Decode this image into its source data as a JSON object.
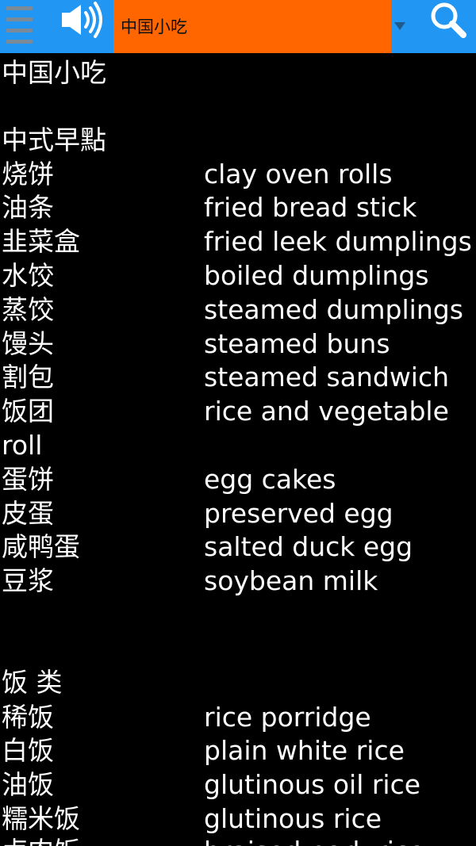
{
  "toolbar": {
    "menu_icon": "hamburger-menu-icon",
    "speaker_icon": "speaker-icon",
    "dropdown_value": "中国小吃",
    "dropdown_icon": "dropdown-arrow-icon",
    "search_icon": "search-icon"
  },
  "content": {
    "title": "中国小吃",
    "section1": {
      "heading": "中式早點",
      "items": [
        {
          "cn": "烧饼",
          "en": "clay oven rolls"
        },
        {
          "cn": "油条",
          "en": "fried bread stick"
        },
        {
          "cn": "韭菜盒",
          "en": "fried leek dumplings"
        },
        {
          "cn": "水饺",
          "en": "boiled dumplings"
        },
        {
          "cn": "蒸饺",
          "en": "steamed dumplings"
        },
        {
          "cn": "馒头",
          "en": "steamed buns"
        },
        {
          "cn": "割包",
          "en": "steamed sandwich"
        },
        {
          "cn": "饭团",
          "en": "rice and vegetable"
        },
        {
          "cn": "roll",
          "en": ""
        },
        {
          "cn": "蛋饼",
          "en": "egg cakes"
        },
        {
          "cn": "皮蛋",
          "en": "preserved egg"
        },
        {
          "cn": "咸鸭蛋",
          "en": "salted duck egg"
        },
        {
          "cn": "豆浆",
          "en": "soybean milk"
        }
      ]
    },
    "section2": {
      "heading": "饭 类",
      "items": [
        {
          "cn": "稀饭",
          "en": "rice porridge"
        },
        {
          "cn": "白饭",
          "en": "plain white rice"
        },
        {
          "cn": "油饭",
          "en": "glutinous oil rice"
        },
        {
          "cn": "糯米饭",
          "en": "glutinous rice"
        },
        {
          "cn": "卤肉饭",
          "en": "braised pork rice"
        }
      ]
    }
  },
  "colors": {
    "toolbar_bg": "#2196F3",
    "dropdown_bg": "#FF6600",
    "content_bg": "#000000",
    "text": "#FFFFFF"
  }
}
